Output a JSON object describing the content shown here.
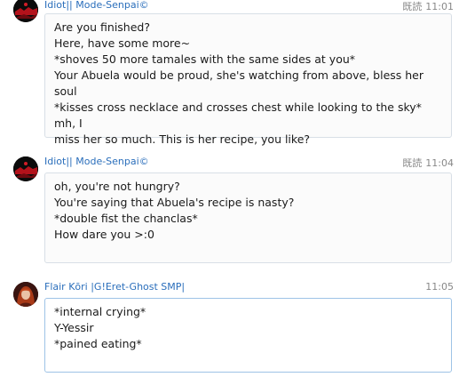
{
  "messages": [
    {
      "sender": "Idiot|| Mode-Senpai©",
      "read": "既読",
      "time": "11:01",
      "avatar_icon": "dark-red-avatar-icon",
      "lines": [
        "Are you finished?",
        "Here, have some more~",
        "*shoves 50 more tamales with the same sides at you*",
        "Your Abuela would be proud, she's watching from above, bless her soul",
        "*kisses cross necklace and crosses chest while looking to the sky* mh, I",
        "miss her so much. This is her recipe, you like?"
      ]
    },
    {
      "sender": "Idiot|| Mode-Senpai©",
      "read": "既読",
      "time": "11:04",
      "avatar_icon": "dark-red-avatar-icon",
      "lines": [
        "oh, you're not hungry?",
        "You're saying that Abuela's recipe is nasty?",
        "*double fist the chanclas*",
        "How dare you >:0"
      ]
    },
    {
      "sender": "Flair Kōri |G!Eret-Ghost SMP|",
      "read": "",
      "time": "11:05",
      "avatar_icon": "red-haired-character-avatar-icon",
      "lines": [
        "*internal crying*",
        "Y-Yessir",
        "*pained eating*"
      ]
    }
  ]
}
